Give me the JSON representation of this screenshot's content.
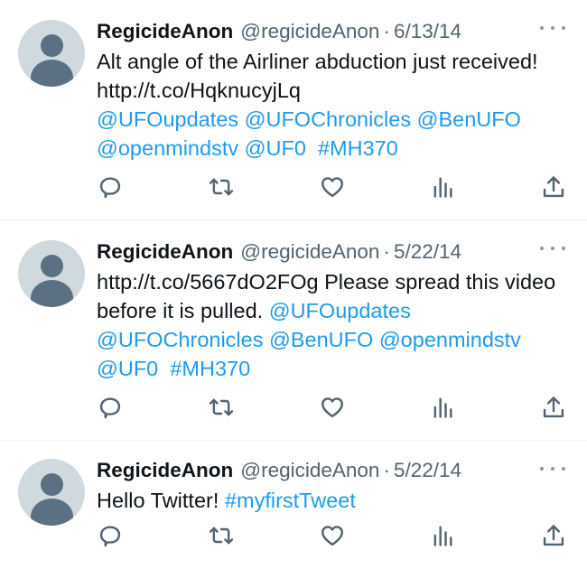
{
  "tweets": [
    {
      "name": "RegicideAnon",
      "handle": "@regicideAnon",
      "separator": "·",
      "date": "6/13/14",
      "text_plain": "Alt angle of the Airliner abduction just received! http://t.co/HqknucyjLq",
      "links": [
        "@UFOupdates",
        "@UFOChronicles",
        "@BenUFO",
        "@openmindstv",
        "@UF0",
        "#MH370"
      ]
    },
    {
      "name": "RegicideAnon",
      "handle": "@regicideAnon",
      "separator": "·",
      "date": "5/22/14",
      "text_plain": "http://t.co/5667dO2FOg Please spread this video before it is pulled.",
      "links": [
        "@UFOupdates",
        "@UFOChronicles",
        "@BenUFO",
        "@openmindstv",
        "@UF0",
        "#MH370"
      ]
    },
    {
      "name": "RegicideAnon",
      "handle": "@regicideAnon",
      "separator": "·",
      "date": "5/22/14",
      "text_plain": "Hello Twitter!",
      "links": [
        "#myfirstTweet"
      ]
    }
  ],
  "icons": {
    "reply": "reply-icon",
    "retweet": "retweet-icon",
    "like": "like-icon",
    "views": "views-icon",
    "share": "share-icon",
    "more": "more-icon",
    "avatar": "default-avatar-icon"
  },
  "colors": {
    "link": "#1d9bf0",
    "text": "#0f1419",
    "secondary": "#536471",
    "avatar_bg": "#cfd9de",
    "avatar_figure": "#5b7083"
  }
}
